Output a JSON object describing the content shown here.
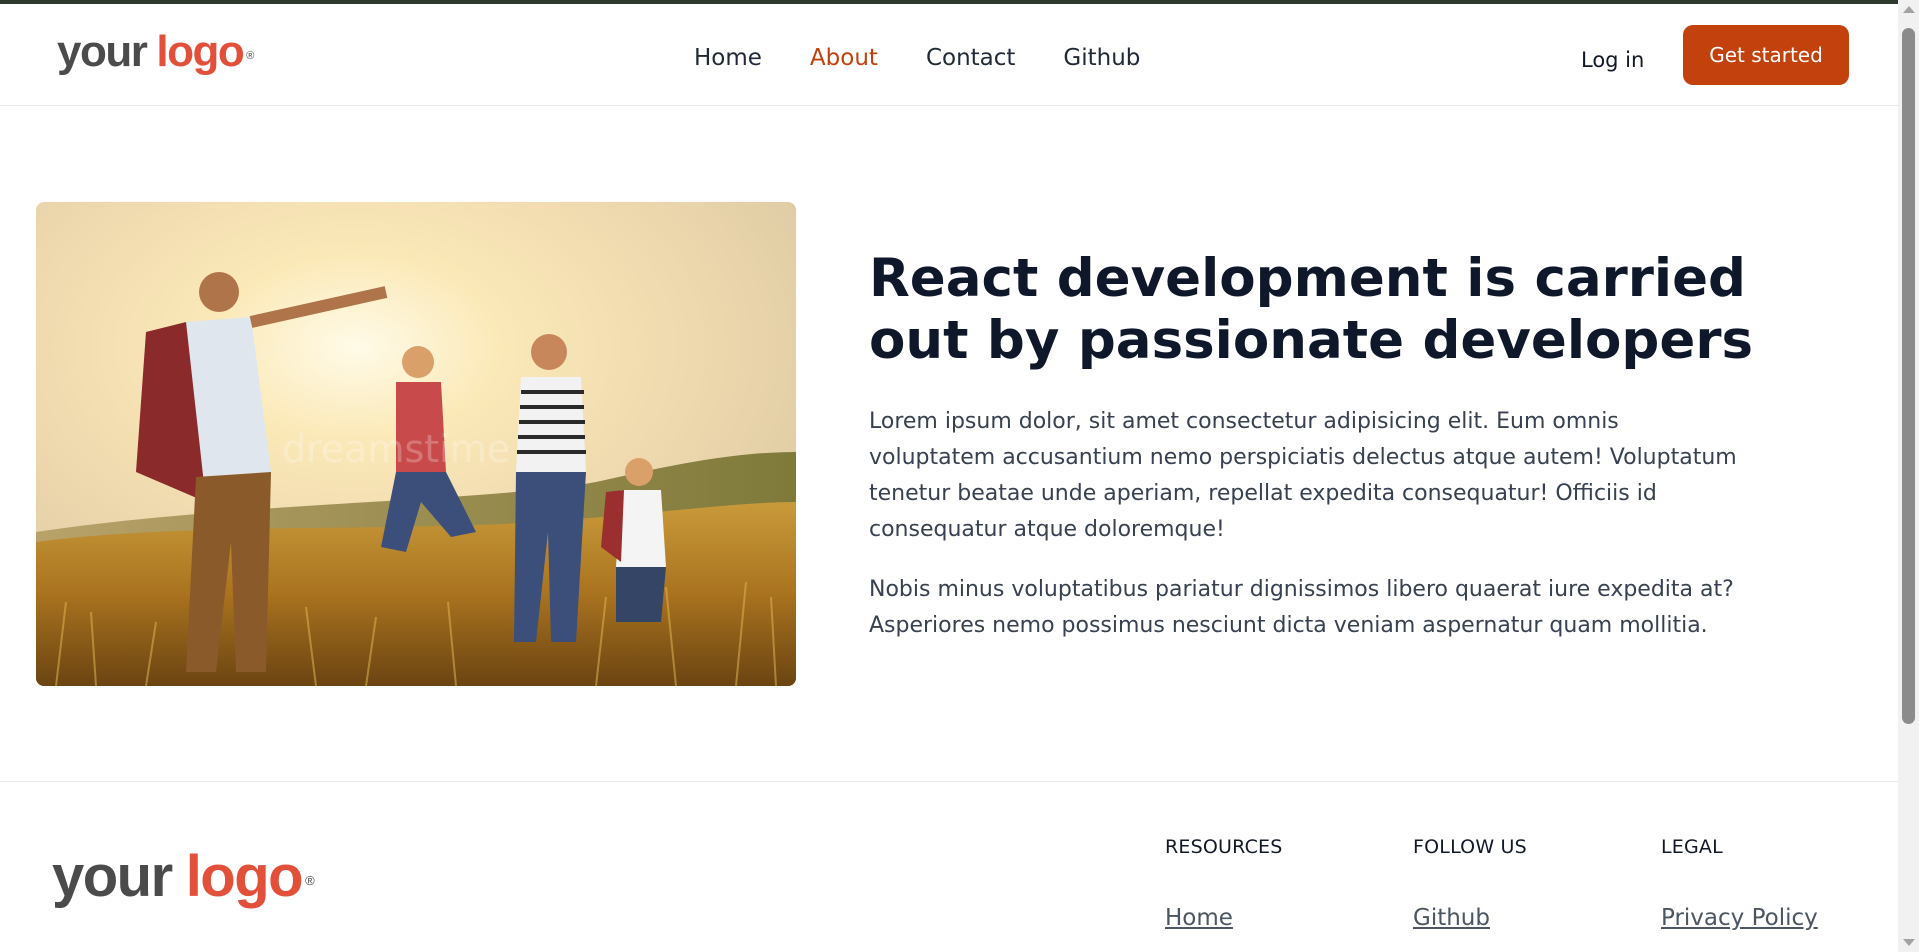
{
  "header": {
    "logo": {
      "your": "your",
      "brand": "logo",
      "reg": "®"
    },
    "nav": [
      {
        "label": "Home",
        "active": false
      },
      {
        "label": "About",
        "active": true
      },
      {
        "label": "Contact",
        "active": false
      },
      {
        "label": "Github",
        "active": false
      }
    ],
    "login_label": "Log in",
    "cta_label": "Get started"
  },
  "main": {
    "image_alt": "dreamstime",
    "heading": "React development is carried out by passionate developers",
    "paragraphs": [
      "Lorem ipsum dolor, sit amet consectetur adipisicing elit. Eum omnis voluptatem accusantium nemo perspiciatis delectus atque autem! Voluptatum tenetur beatae unde aperiam, repellat expedita consequatur! Officiis id consequatur atque doloremque!",
      "Nobis minus voluptatibus pariatur dignissimos libero quaerat iure expedita at? Asperiores nemo possimus nesciunt dicta veniam aspernatur quam mollitia."
    ]
  },
  "footer": {
    "logo": {
      "your": "your",
      "brand": "logo",
      "reg": "®"
    },
    "columns": [
      {
        "title": "RESOURCES",
        "links": [
          "Home"
        ]
      },
      {
        "title": "FOLLOW US",
        "links": [
          "Github"
        ]
      },
      {
        "title": "LEGAL",
        "links": [
          "Privacy Policy"
        ]
      }
    ]
  },
  "colors": {
    "accent": "#c2410c",
    "heading": "#0f172a",
    "body_text": "#374151",
    "logo_red": "#e2503a",
    "logo_gray": "#4b4b4b"
  }
}
